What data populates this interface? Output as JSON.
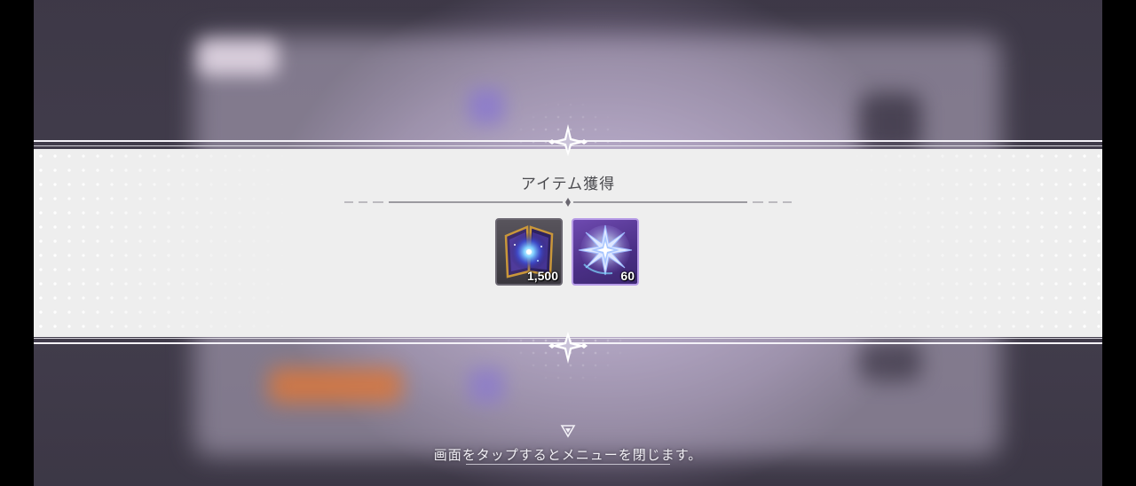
{
  "dialog": {
    "title": "アイテム獲得",
    "items": [
      {
        "name": "book-item",
        "count": "1,500"
      },
      {
        "name": "crystal-item",
        "count": "60"
      }
    ]
  },
  "footer": {
    "tap_to_close": "画面をタップするとメニューを閉じます。"
  },
  "colors": {
    "band": "#eeeeee",
    "title_text": "#4a4a4e",
    "crystal_slot_border": "#b59ae6",
    "book_slot_border": "#6a6670"
  },
  "icons": [
    "sparkle-ornament-icon",
    "book-icon",
    "crystal-icon",
    "down-triangle-icon"
  ]
}
